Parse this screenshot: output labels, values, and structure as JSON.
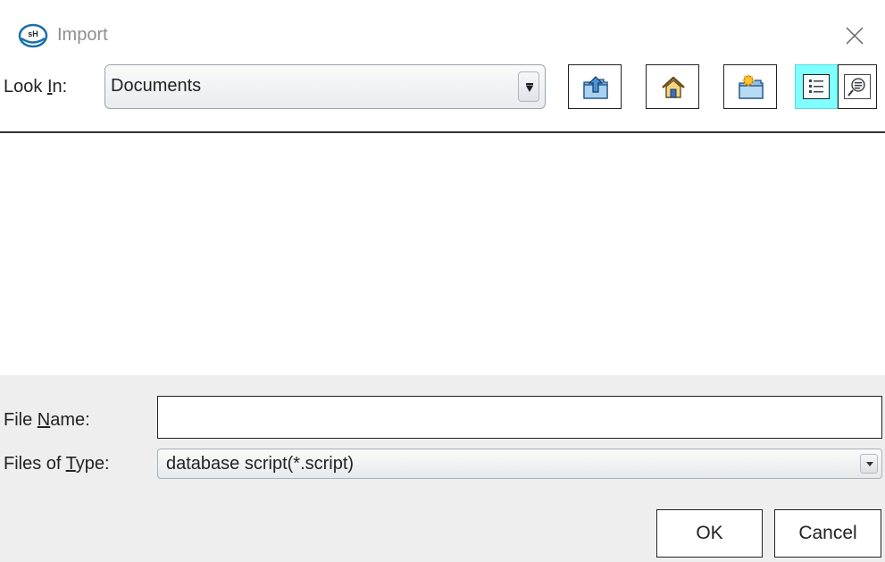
{
  "window": {
    "title": "Import",
    "app_icon_text": "sH",
    "close_icon": "close-icon"
  },
  "toolbar": {
    "look_in": {
      "label_prefix": "Look ",
      "label_mnemonic": "I",
      "label_suffix": "n:",
      "value": "Documents"
    },
    "buttons": [
      {
        "name": "up-one-level-button",
        "icon": "folder-up-icon"
      },
      {
        "name": "home-button",
        "icon": "home-icon"
      },
      {
        "name": "new-folder-button",
        "icon": "new-folder-icon"
      }
    ],
    "view_toggles": [
      {
        "name": "list-view-toggle",
        "icon": "list-view-icon",
        "selected": true
      },
      {
        "name": "details-view-toggle",
        "icon": "details-view-icon",
        "selected": false
      }
    ]
  },
  "file_list": {
    "items": []
  },
  "file_name": {
    "label_prefix": "File ",
    "label_mnemonic": "N",
    "label_suffix": "ame:",
    "value": ""
  },
  "files_of_type": {
    "label_prefix": "Files of ",
    "label_mnemonic": "T",
    "label_suffix": "ype:",
    "value": "database script(*.script)"
  },
  "actions": {
    "ok_label": "OK",
    "cancel_label": "Cancel"
  },
  "colors": {
    "selected_toggle": "#7fffff",
    "panel_background": "#eeeeee",
    "title_text": "#8e8e8e"
  }
}
